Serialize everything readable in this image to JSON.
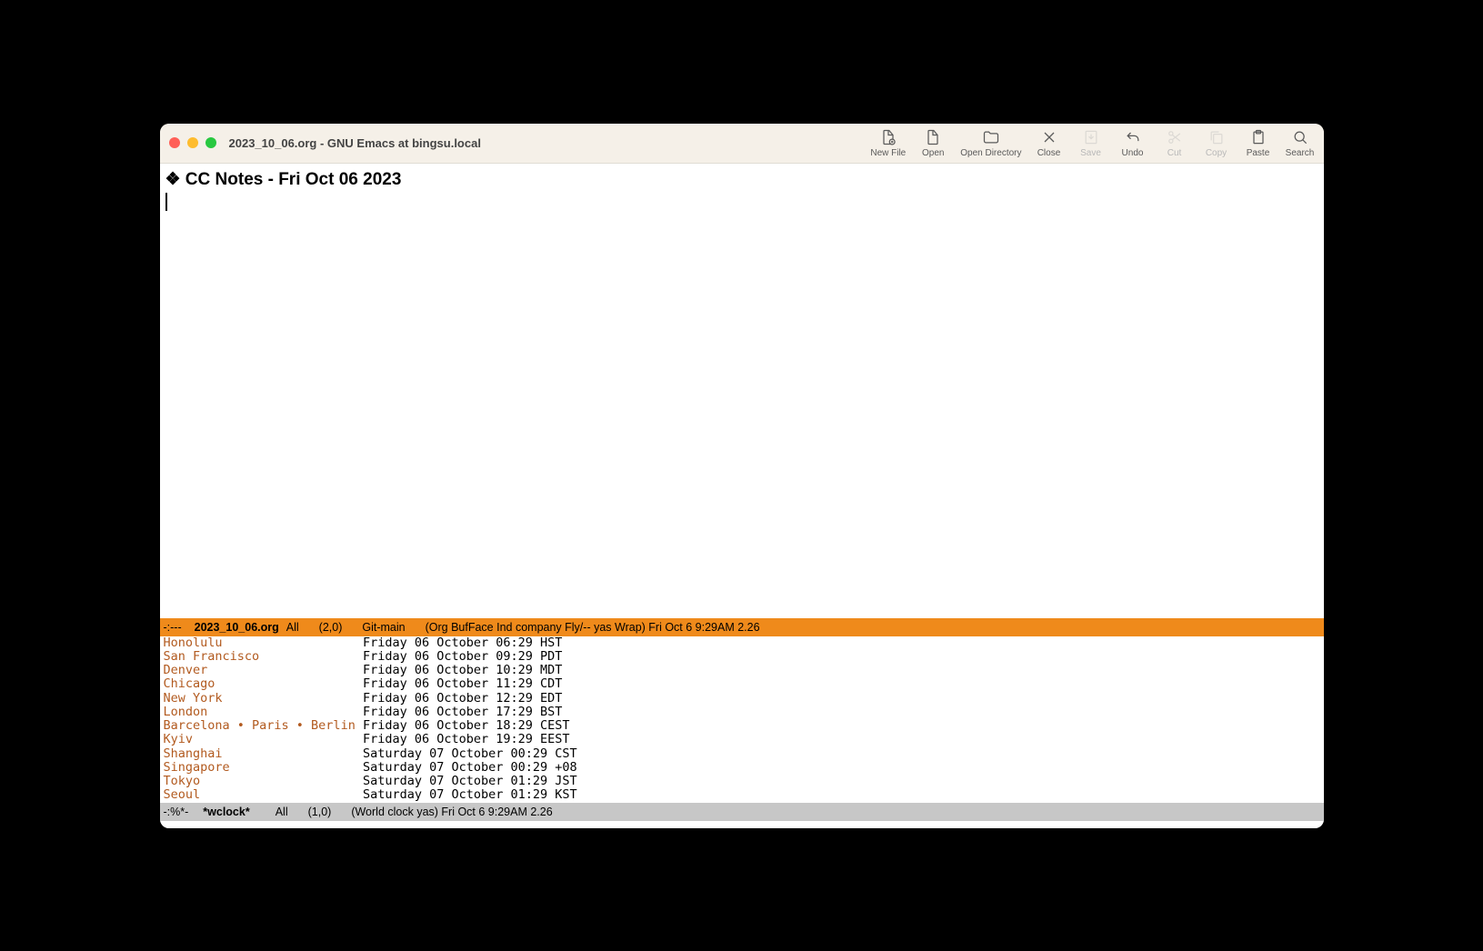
{
  "window_title": "2023_10_06.org - GNU Emacs at bingsu.local",
  "toolbar": {
    "new_file": "New File",
    "open": "Open",
    "open_dir": "Open Directory",
    "close": "Close",
    "save": "Save",
    "undo": "Undo",
    "cut": "Cut",
    "copy": "Copy",
    "paste": "Paste",
    "search": "Search"
  },
  "headline": "❖ CC Notes - Fri Oct 06 2023",
  "modeline_top": {
    "prefix": "-:---",
    "buffer": "2023_10_06.org",
    "pos": "All",
    "rowcol": "(2,0)",
    "vc": "Git-main",
    "modes": "(Org BufFace Ind company Fly/-- yas Wrap) Fri Oct  6 9:29AM 2.26"
  },
  "wclock": [
    {
      "city": "Honolulu",
      "time": "Friday 06 October 06:29 HST"
    },
    {
      "city": "San Francisco",
      "time": "Friday 06 October 09:29 PDT"
    },
    {
      "city": "Denver",
      "time": "Friday 06 October 10:29 MDT"
    },
    {
      "city": "Chicago",
      "time": "Friday 06 October 11:29 CDT"
    },
    {
      "city": "New York",
      "time": "Friday 06 October 12:29 EDT"
    },
    {
      "city": "London",
      "time": "Friday 06 October 17:29 BST"
    },
    {
      "city": "Barcelona • Paris • Berlin",
      "time": "Friday 06 October 18:29 CEST"
    },
    {
      "city": "Kyiv",
      "time": "Friday 06 October 19:29 EEST"
    },
    {
      "city": "Shanghai",
      "time": "Saturday 07 October 00:29 CST"
    },
    {
      "city": "Singapore",
      "time": "Saturday 07 October 00:29 +08"
    },
    {
      "city": "Tokyo",
      "time": "Saturday 07 October 01:29 JST"
    },
    {
      "city": "Seoul",
      "time": "Saturday 07 October 01:29 KST"
    }
  ],
  "wclock_citywidth": 27,
  "modeline_bot": {
    "prefix": "-:%*-",
    "buffer": "*wclock*",
    "pos": "All",
    "rowcol": "(1,0)",
    "modes": "(World clock yas) Fri Oct  6 9:29AM 2.26"
  }
}
